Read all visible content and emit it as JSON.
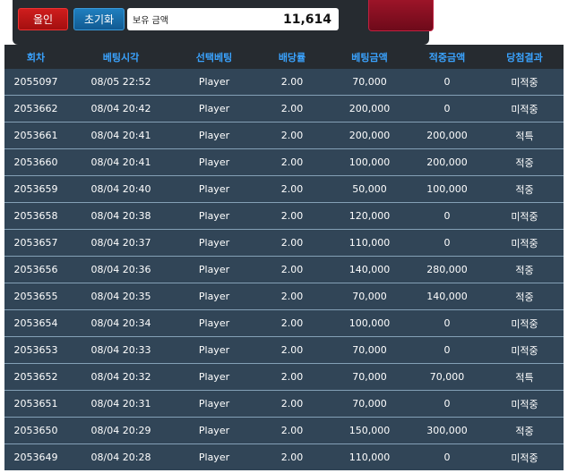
{
  "controls": {
    "allin_label": "올인",
    "reset_label": "초기화",
    "balance_label": "보유 금액",
    "balance_value": "11,614"
  },
  "colors": {
    "cancel": "#ff2a2a",
    "win": "#ff9f1c",
    "header_text": "#3aa3ff",
    "row_bg": "#314557"
  },
  "table": {
    "headers": [
      "회차",
      "베팅시각",
      "선택베팅",
      "배당률",
      "베팅금액",
      "적중금액",
      "당첨결과"
    ],
    "rows": [
      {
        "round": "2055097",
        "time": "08/05 22:52",
        "pick": "Player",
        "odds": "2.00",
        "bet": "70,000",
        "win": "0",
        "result": "미적중",
        "status": "cancel"
      },
      {
        "round": "2053662",
        "time": "08/04 20:42",
        "pick": "Player",
        "odds": "2.00",
        "bet": "200,000",
        "win": "0",
        "result": "미적중",
        "status": "cancel"
      },
      {
        "round": "2053661",
        "time": "08/04 20:41",
        "pick": "Player",
        "odds": "2.00",
        "bet": "200,000",
        "win": "200,000",
        "result": "적특",
        "status": "win"
      },
      {
        "round": "2053660",
        "time": "08/04 20:41",
        "pick": "Player",
        "odds": "2.00",
        "bet": "100,000",
        "win": "200,000",
        "result": "적중",
        "status": "win"
      },
      {
        "round": "2053659",
        "time": "08/04 20:40",
        "pick": "Player",
        "odds": "2.00",
        "bet": "50,000",
        "win": "100,000",
        "result": "적중",
        "status": "win"
      },
      {
        "round": "2053658",
        "time": "08/04 20:38",
        "pick": "Player",
        "odds": "2.00",
        "bet": "120,000",
        "win": "0",
        "result": "미적중",
        "status": "cancel"
      },
      {
        "round": "2053657",
        "time": "08/04 20:37",
        "pick": "Player",
        "odds": "2.00",
        "bet": "110,000",
        "win": "0",
        "result": "미적중",
        "status": "cancel"
      },
      {
        "round": "2053656",
        "time": "08/04 20:36",
        "pick": "Player",
        "odds": "2.00",
        "bet": "140,000",
        "win": "280,000",
        "result": "적중",
        "status": "win"
      },
      {
        "round": "2053655",
        "time": "08/04 20:35",
        "pick": "Player",
        "odds": "2.00",
        "bet": "70,000",
        "win": "140,000",
        "result": "적중",
        "status": "win"
      },
      {
        "round": "2053654",
        "time": "08/04 20:34",
        "pick": "Player",
        "odds": "2.00",
        "bet": "100,000",
        "win": "0",
        "result": "미적중",
        "status": "cancel"
      },
      {
        "round": "2053653",
        "time": "08/04 20:33",
        "pick": "Player",
        "odds": "2.00",
        "bet": "70,000",
        "win": "0",
        "result": "미적중",
        "status": "cancel"
      },
      {
        "round": "2053652",
        "time": "08/04 20:32",
        "pick": "Player",
        "odds": "2.00",
        "bet": "70,000",
        "win": "70,000",
        "result": "적특",
        "status": "win"
      },
      {
        "round": "2053651",
        "time": "08/04 20:31",
        "pick": "Player",
        "odds": "2.00",
        "bet": "70,000",
        "win": "0",
        "result": "미적중",
        "status": "cancel"
      },
      {
        "round": "2053650",
        "time": "08/04 20:29",
        "pick": "Player",
        "odds": "2.00",
        "bet": "150,000",
        "win": "300,000",
        "result": "적중",
        "status": "win"
      },
      {
        "round": "2053649",
        "time": "08/04 20:28",
        "pick": "Player",
        "odds": "2.00",
        "bet": "110,000",
        "win": "0",
        "result": "미적중",
        "status": "cancel"
      }
    ]
  }
}
